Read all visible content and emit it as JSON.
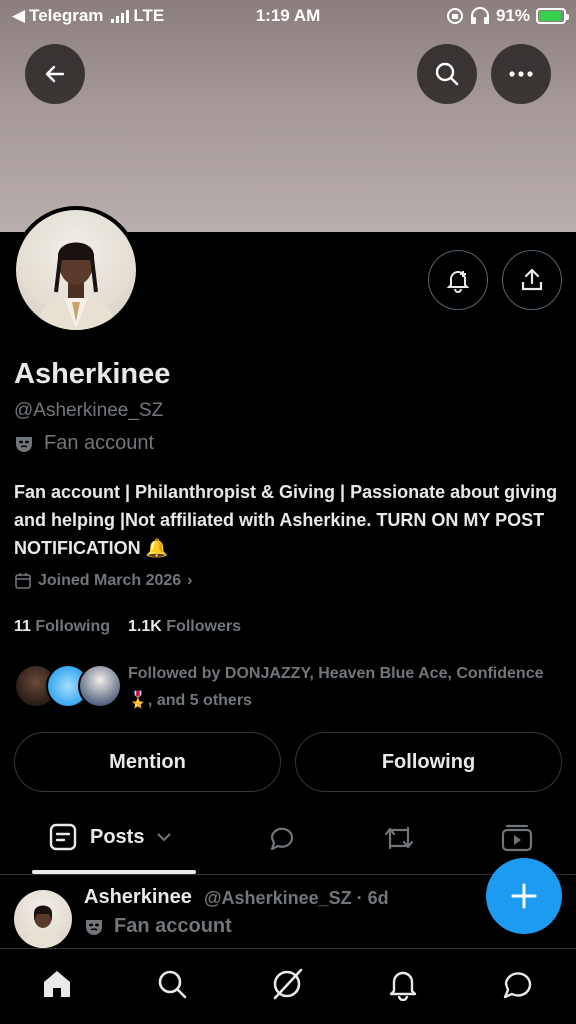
{
  "status_bar": {
    "back_app": "Telegram",
    "network": "LTE",
    "time": "1:19 AM",
    "battery": "91%",
    "battery_level": 0.91
  },
  "profile": {
    "name": "Asherkinee",
    "handle": "@Asherkinee_SZ",
    "label": "Fan account",
    "bio": "Fan account | Philanthropist & Giving | Passionate about giving and helping |Not affiliated with Asherkine. TURN ON MY POST NOTIFICATION 🔔",
    "joined": "Joined March 2026",
    "following_count": "11",
    "following_label": "Following",
    "followers_count": "1.1K",
    "followers_label": "Followers",
    "followed_by": "Followed by DONJAZZY, Heaven Blue Ace, Confidence 🎖️, and 5 others"
  },
  "actions": {
    "mention": "Mention",
    "following": "Following"
  },
  "tabs": {
    "posts": "Posts"
  },
  "post": {
    "name": "Asherkinee",
    "meta": "@Asherkinee_SZ · 6d",
    "label": "Fan account"
  },
  "colors": {
    "accent": "#1d9bf0",
    "muted": "#71767b",
    "text": "#e7e9ea"
  }
}
